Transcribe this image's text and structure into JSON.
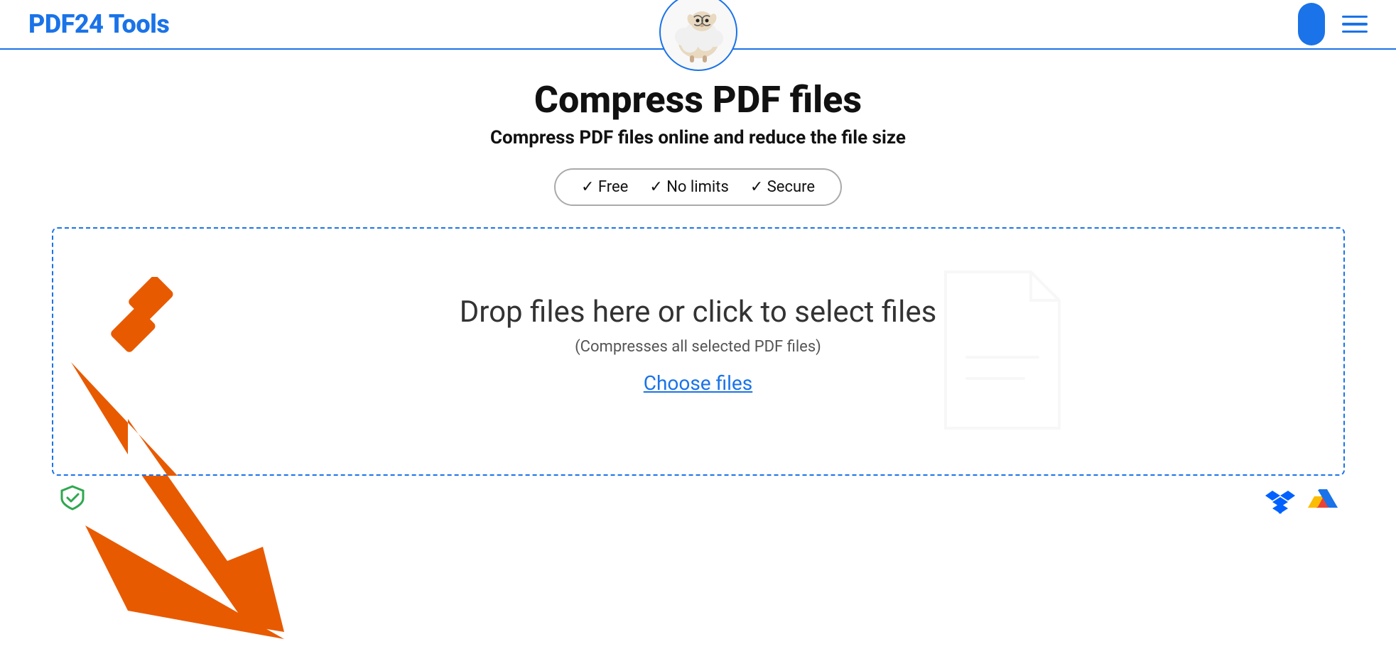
{
  "header": {
    "logo": "PDF24 Tools",
    "user_icon_label": "user-profile",
    "hamburger_label": "menu"
  },
  "hero": {
    "title": "Compress PDF files",
    "subtitle": "Compress PDF files online and reduce the file size",
    "badges": {
      "text": "✓ Free  ✓ No limits  ✓ Secure",
      "item1": "✓ Free",
      "item2": "✓ No limits",
      "item3": "✓ Secure"
    }
  },
  "dropzone": {
    "main_text": "Drop files here or click to select files",
    "sub_text": "(Compresses all selected PDF files)",
    "choose_files": "Choose files"
  }
}
